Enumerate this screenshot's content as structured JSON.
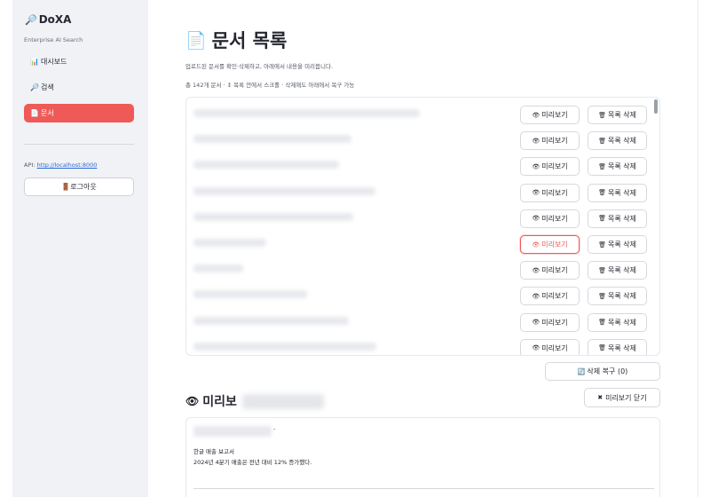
{
  "sidebar": {
    "brand": {
      "icon": "🔎",
      "name": "DoXA"
    },
    "tagline": "Enterprise AI Search",
    "nav": [
      {
        "icon": "📊",
        "label": "대시보드",
        "active": false
      },
      {
        "icon": "🔎",
        "label": "검색",
        "active": false
      },
      {
        "icon": "📄",
        "label": "문서",
        "active": true
      }
    ],
    "api_label": "API:",
    "api_url": "http://localhost:8000",
    "logout_icon": "🚪",
    "logout_label": "로그아웃"
  },
  "main": {
    "title_icon": "📄",
    "title": "문서 목록",
    "subtitle": "업로드된 문서를 확인·삭제하고, 아래에서 내용을 미리봅니다.",
    "count_text": "총 142개 문서 · ↕ 목록 안에서 스크롤 · 삭제해도 아래에서 복구 가능",
    "buttons": {
      "preview_icon": "👁",
      "preview_label": "미리보기",
      "delete_icon": "🗑",
      "delete_label": "목록 삭제"
    },
    "rows_count": 10,
    "selected_row": 5,
    "restore_icon": "🔄",
    "restore_label": "삭제 복구 (0)",
    "close_preview_icon": "✖",
    "close_preview_label": "미리보기 닫기"
  },
  "preview": {
    "icon": "👁",
    "title": "미리보",
    "separator": "-",
    "line1": "한글 매출 보고서",
    "line2": "2024년 4분기 매출은 전년 대비 12% 증가했다."
  },
  "colors": {
    "accent": "#ef5a58",
    "sidebar_bg": "#f0f2f6",
    "link": "#2b68d8"
  }
}
